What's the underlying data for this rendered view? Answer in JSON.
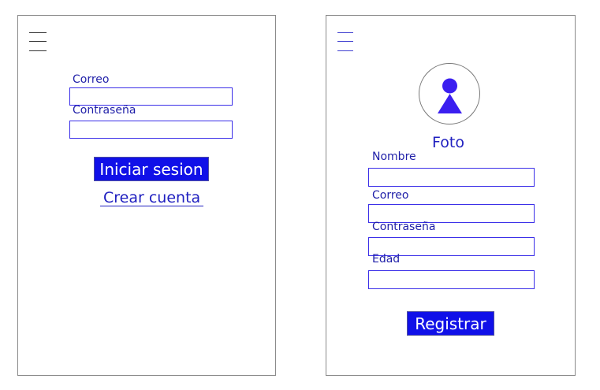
{
  "login": {
    "email_label": "Correo",
    "password_label": "Contraseña",
    "login_button": "Iniciar sesion",
    "create_account_link": "Crear cuenta"
  },
  "register": {
    "photo_label": "Foto",
    "name_label": "Nombre",
    "email_label": "Correo",
    "password_label": "Contraseña",
    "age_label": "Edad",
    "register_button": "Registrar"
  },
  "colors": {
    "accent": "#1010e8",
    "input_border": "#3a2ee8",
    "label_text": "#1f1fa8",
    "avatar_fill": "#3b1ff0"
  },
  "icons": [
    "hamburger-menu-icon",
    "user-avatar-icon"
  ]
}
